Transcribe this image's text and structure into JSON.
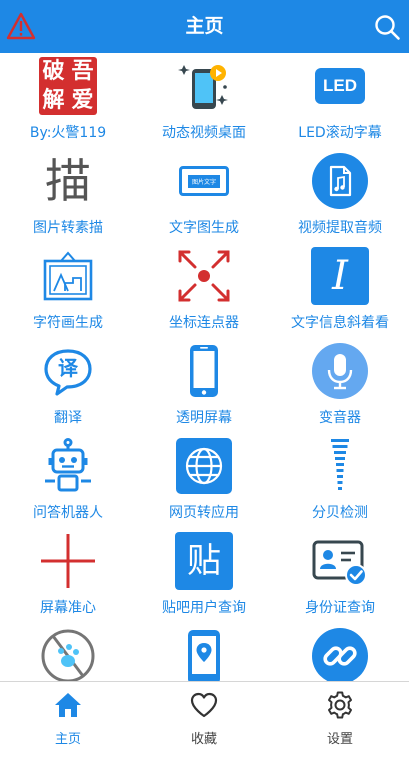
{
  "header": {
    "title": "主页",
    "warning_icon": "warning-triangle-icon",
    "search_icon": "search-icon"
  },
  "colors": {
    "primary": "#1e88e5",
    "red": "#d32f2f",
    "white": "#ffffff"
  },
  "grid": {
    "items": [
      {
        "label": "By:火警119",
        "icon": "seal-logo-icon",
        "seal_chars": [
          "破",
          "吾",
          "解",
          "爱"
        ]
      },
      {
        "label": "动态视频桌面",
        "icon": "video-wallpaper-icon"
      },
      {
        "label": "LED滚动字幕",
        "icon": "led-icon",
        "icon_text": "LED"
      },
      {
        "label": "图片转素描",
        "icon": "sketch-char-icon",
        "icon_text": "描"
      },
      {
        "label": "文字图生成",
        "icon": "text-image-icon",
        "icon_text": "图片文字"
      },
      {
        "label": "视频提取音频",
        "icon": "music-file-icon"
      },
      {
        "label": "字符画生成",
        "icon": "picture-frame-icon"
      },
      {
        "label": "坐标连点器",
        "icon": "target-arrows-icon"
      },
      {
        "label": "文字信息斜着看",
        "icon": "italic-icon",
        "icon_text": "I"
      },
      {
        "label": "翻译",
        "icon": "translate-bubble-icon",
        "icon_text": "译"
      },
      {
        "label": "透明屏幕",
        "icon": "phone-icon"
      },
      {
        "label": "变音器",
        "icon": "microphone-icon"
      },
      {
        "label": "问答机器人",
        "icon": "robot-icon"
      },
      {
        "label": "网页转应用",
        "icon": "globe-icon"
      },
      {
        "label": "分贝检测",
        "icon": "decibel-bars-icon"
      },
      {
        "label": "屏幕准心",
        "icon": "crosshair-icon"
      },
      {
        "label": "贴吧用户查询",
        "icon": "tieba-icon",
        "icon_text": "贴"
      },
      {
        "label": "身份证查询",
        "icon": "id-card-icon"
      },
      {
        "label": "",
        "icon": "paw-circle-icon"
      },
      {
        "label": "",
        "icon": "location-phone-icon"
      },
      {
        "label": "",
        "icon": "link-icon"
      }
    ]
  },
  "tabs": [
    {
      "label": "主页",
      "icon": "home-icon",
      "active": true
    },
    {
      "label": "收藏",
      "icon": "heart-icon",
      "active": false
    },
    {
      "label": "设置",
      "icon": "gear-icon",
      "active": false
    }
  ]
}
